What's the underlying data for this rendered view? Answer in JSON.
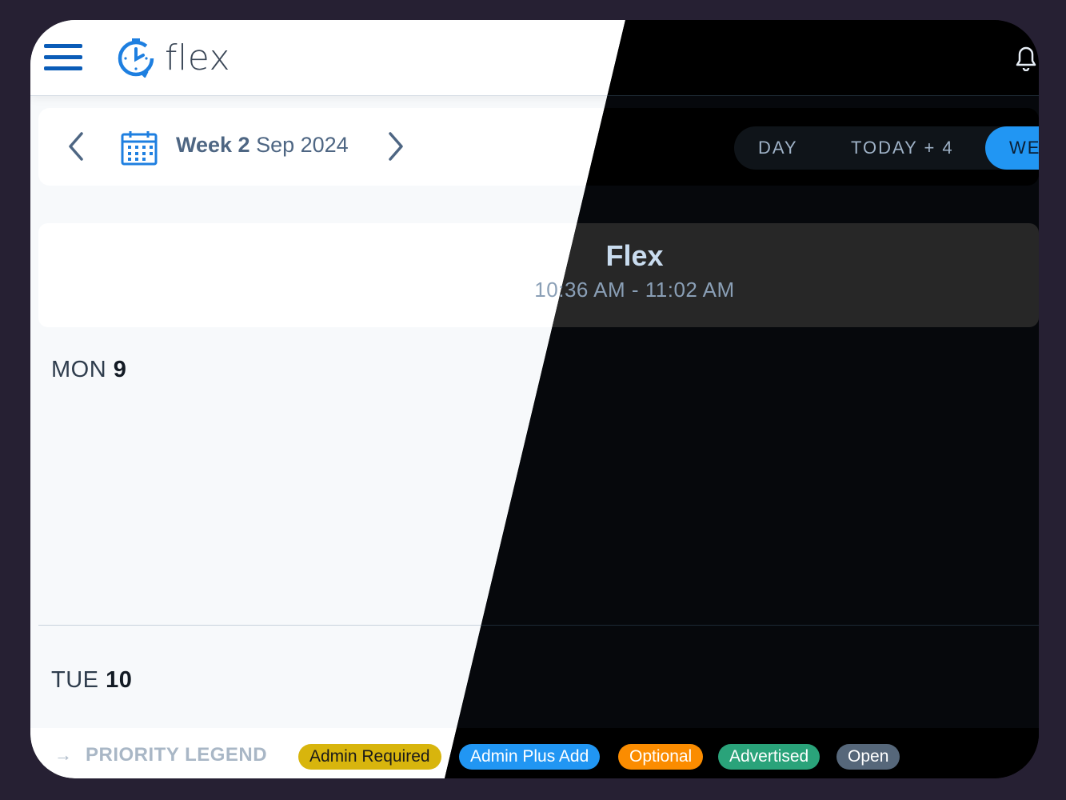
{
  "app": {
    "name": "flex"
  },
  "week": {
    "prefix": "Week 2",
    "month": "Sep 2024"
  },
  "view_tabs": [
    {
      "label": "DAY"
    },
    {
      "label": "TODAY + 4"
    },
    {
      "label": "WE"
    }
  ],
  "event": {
    "title": "Flex",
    "time": "10:36 AM - 11:02 AM"
  },
  "days": [
    {
      "dow": "MON",
      "num": "9"
    },
    {
      "dow": "TUE",
      "num": "10"
    }
  ],
  "legend": {
    "title": "PRIORITY LEGEND",
    "items": [
      {
        "label": "Admin Required",
        "color": "#d8b50d"
      },
      {
        "label": "Admin Plus Add",
        "color": "#2196f3"
      },
      {
        "label": "Optional",
        "color": "#fb8c00"
      },
      {
        "label": "Advertised",
        "color": "#2aa37a"
      },
      {
        "label": "Open",
        "color": "#56677a"
      }
    ]
  },
  "icons": [
    "menu-icon",
    "flex-logo-icon",
    "bell-icon",
    "chevron-left-icon",
    "calendar-icon",
    "chevron-right-icon",
    "arrow-right-icon"
  ]
}
